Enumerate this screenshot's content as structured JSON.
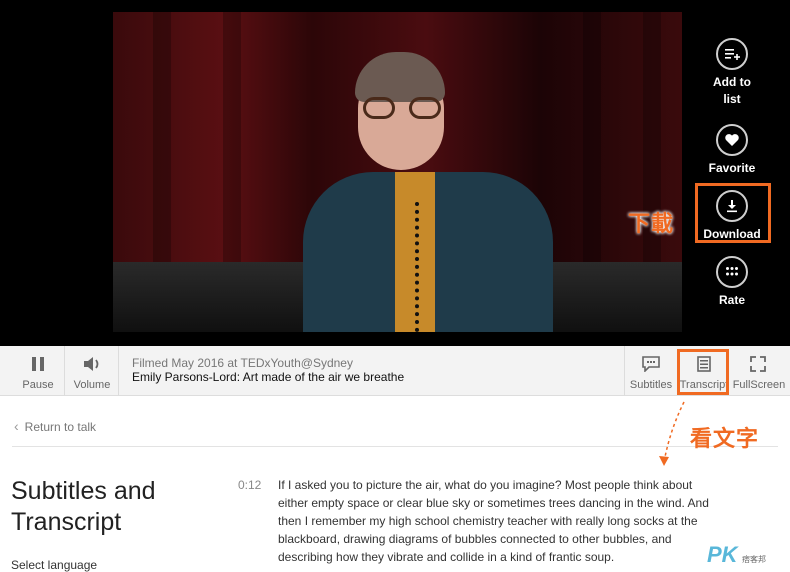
{
  "actions": {
    "add_to_list": "Add to list",
    "add_to_list_l1": "Add to",
    "add_to_list_l2": "list",
    "favorite": "Favorite",
    "download": "Download",
    "rate": "Rate"
  },
  "annotations": {
    "download_note": "下載",
    "transcript_note": "看文字"
  },
  "stage_letters": "...",
  "controls": {
    "pause": "Pause",
    "volume": "Volume",
    "filmed": "Filmed May 2016 at TEDxYouth@Sydney",
    "talk_title": "Emily Parsons-Lord: Art made of the air we breathe",
    "subtitles": "Subtitles",
    "transcript": "Transcript",
    "fullscreen": "FullScreen"
  },
  "panel": {
    "back": "Return to talk",
    "heading_l1": "Subtitles and",
    "heading_l2": "Transcript",
    "select_language": "Select language",
    "timestamp": "0:12",
    "paragraph": "If I asked you to picture the air, what do you imagine? Most people think about either empty space or clear blue sky or sometimes trees dancing in the wind. And then I remember my high school chemistry teacher with really long socks at the blackboard, drawing diagrams of bubbles connected to other bubbles, and describing how they vibrate and collide in a kind of frantic soup."
  },
  "watermark": {
    "logo": "PK",
    "sub": "痞客邦"
  },
  "colors": {
    "accent": "#f06a22",
    "control_bg": "#f3f3f3",
    "stage_bg": "#000000"
  }
}
